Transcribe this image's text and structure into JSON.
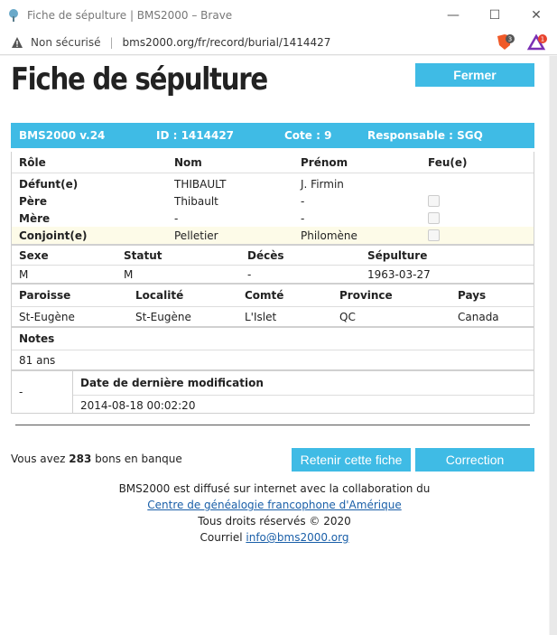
{
  "window": {
    "title": "Fiche de sépulture | BMS2000 – Brave",
    "insecure_label": "Non sécurisé",
    "url": "bms2000.org/fr/record/burial/1414427",
    "brave_badge": "3",
    "rewards_badge": "1"
  },
  "page": {
    "title": "Fiche de sépulture",
    "close_label": "Fermer"
  },
  "record": {
    "header": {
      "version": "BMS2000 v.24",
      "id": "ID : 1414427",
      "cote": "Cote : 9",
      "responsable": "Responsable : SGQ"
    },
    "persons_headers": [
      "Rôle",
      "Nom",
      "Prénom",
      "Feu(e)"
    ],
    "persons": [
      {
        "role": "Défunt(e)",
        "nom": "THIBAULT",
        "prenom": "J. Firmin"
      },
      {
        "role": "Père",
        "nom": "Thibault",
        "prenom": "-"
      },
      {
        "role": "Mère",
        "nom": "-",
        "prenom": "-"
      },
      {
        "role": "Conjoint(e)",
        "nom": "Pelletier",
        "prenom": "Philomène"
      }
    ],
    "vitals_headers": [
      "Sexe",
      "Statut",
      "Décès",
      "Sépulture"
    ],
    "vitals": [
      "M",
      "M",
      "-",
      "1963-03-27"
    ],
    "place_headers": [
      "Paroisse",
      "Localité",
      "Comté",
      "Province",
      "Pays"
    ],
    "place": [
      "St-Eugène",
      "St-Eugène",
      "L'Islet",
      "QC",
      "Canada"
    ],
    "notes_header": "Notes",
    "notes": "81 ans",
    "mod_left": "-",
    "mod_header": "Date de dernière modification",
    "mod_value": "2014-08-18 00:02:20"
  },
  "bank": {
    "prefix": "Vous avez ",
    "count": "283",
    "suffix": " bons en banque"
  },
  "actions": {
    "keep_label": "Retenir cette fiche",
    "correction_label": "Correction"
  },
  "footer": {
    "line1": "BMS2000 est diffusé sur internet avec la collaboration du",
    "link1": "Centre de généalogie francophone d'Amérique",
    "line3": "Tous droits réservés © 2020",
    "courriel": "Courriel ",
    "email": "info@bms2000.org"
  }
}
